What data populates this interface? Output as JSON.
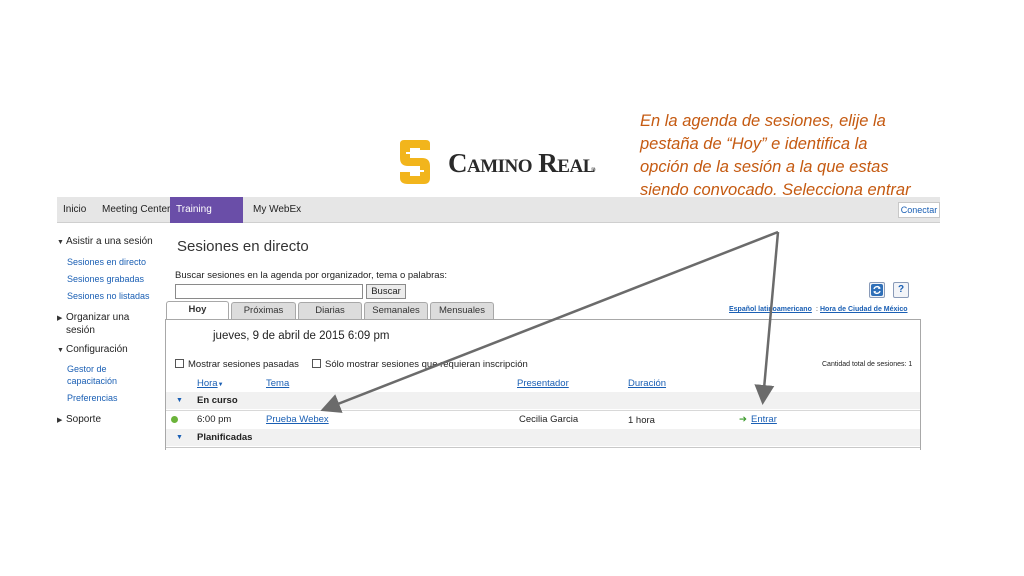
{
  "annotation": {
    "text": "En la agenda de sesiones, elije la pestaña de “Hoy” e identifica la opción de la sesión a la que estas siendo convocado. Selecciona entrar"
  },
  "logo": {
    "text": "Camino Real",
    "registered": "®",
    "icon": "camino-real-logo-icon"
  },
  "topnav": {
    "tabs": [
      "Inicio",
      "Meeting Center",
      "Training Center",
      "My WebEx"
    ],
    "active": "Training Center",
    "connect_label": "Conectar"
  },
  "sidebar": {
    "section1": "Asistir a una sesión",
    "links1": [
      "Sesiones en directo",
      "Sesiones grabadas",
      "Sesiones no listadas"
    ],
    "section2_line1": "Organizar una",
    "section2_line2": "sesión",
    "section3": "Configuración",
    "links3_a1": "Gestor de",
    "links3_a2": "capacitación",
    "links3_b": "Preferencias",
    "section4": "Soporte"
  },
  "main": {
    "title": "Sesiones en directo",
    "search_label": "Buscar sesiones en la agenda por organizador, tema o palabras:",
    "search_value": "",
    "search_button": "Buscar",
    "help_label": "?",
    "tabs": [
      "Hoy",
      "Próximas",
      "Diarias",
      "Semanales",
      "Mensuales"
    ],
    "active_tab": "Hoy",
    "language_link": "Español latinoamericano",
    "timezone_link": "Hora de Ciudad de México",
    "date": "jueves, 9 de abril de 2015 6:09 pm",
    "checkbox1": "Mostrar sesiones pasadas",
    "checkbox2": "Sólo mostrar sesiones que requieran inscripción",
    "total_sessions": "Cantidad total de sesiones: 1",
    "columns": {
      "hora": "Hora",
      "tema": "Tema",
      "presentador": "Presentador",
      "duracion": "Duración"
    },
    "group_in_progress": "En curso",
    "session": {
      "time": "6:00 pm",
      "topic": "Prueba Webex",
      "presenter": "Cecilia Garcia",
      "duration": "1 hora",
      "action": "Entrar"
    },
    "group_planned": "Planificadas"
  },
  "colors": {
    "accent": "#6a4ea8",
    "link": "#1a5fb4",
    "annotation": "#c55a11",
    "logo": "#f2b51c"
  }
}
